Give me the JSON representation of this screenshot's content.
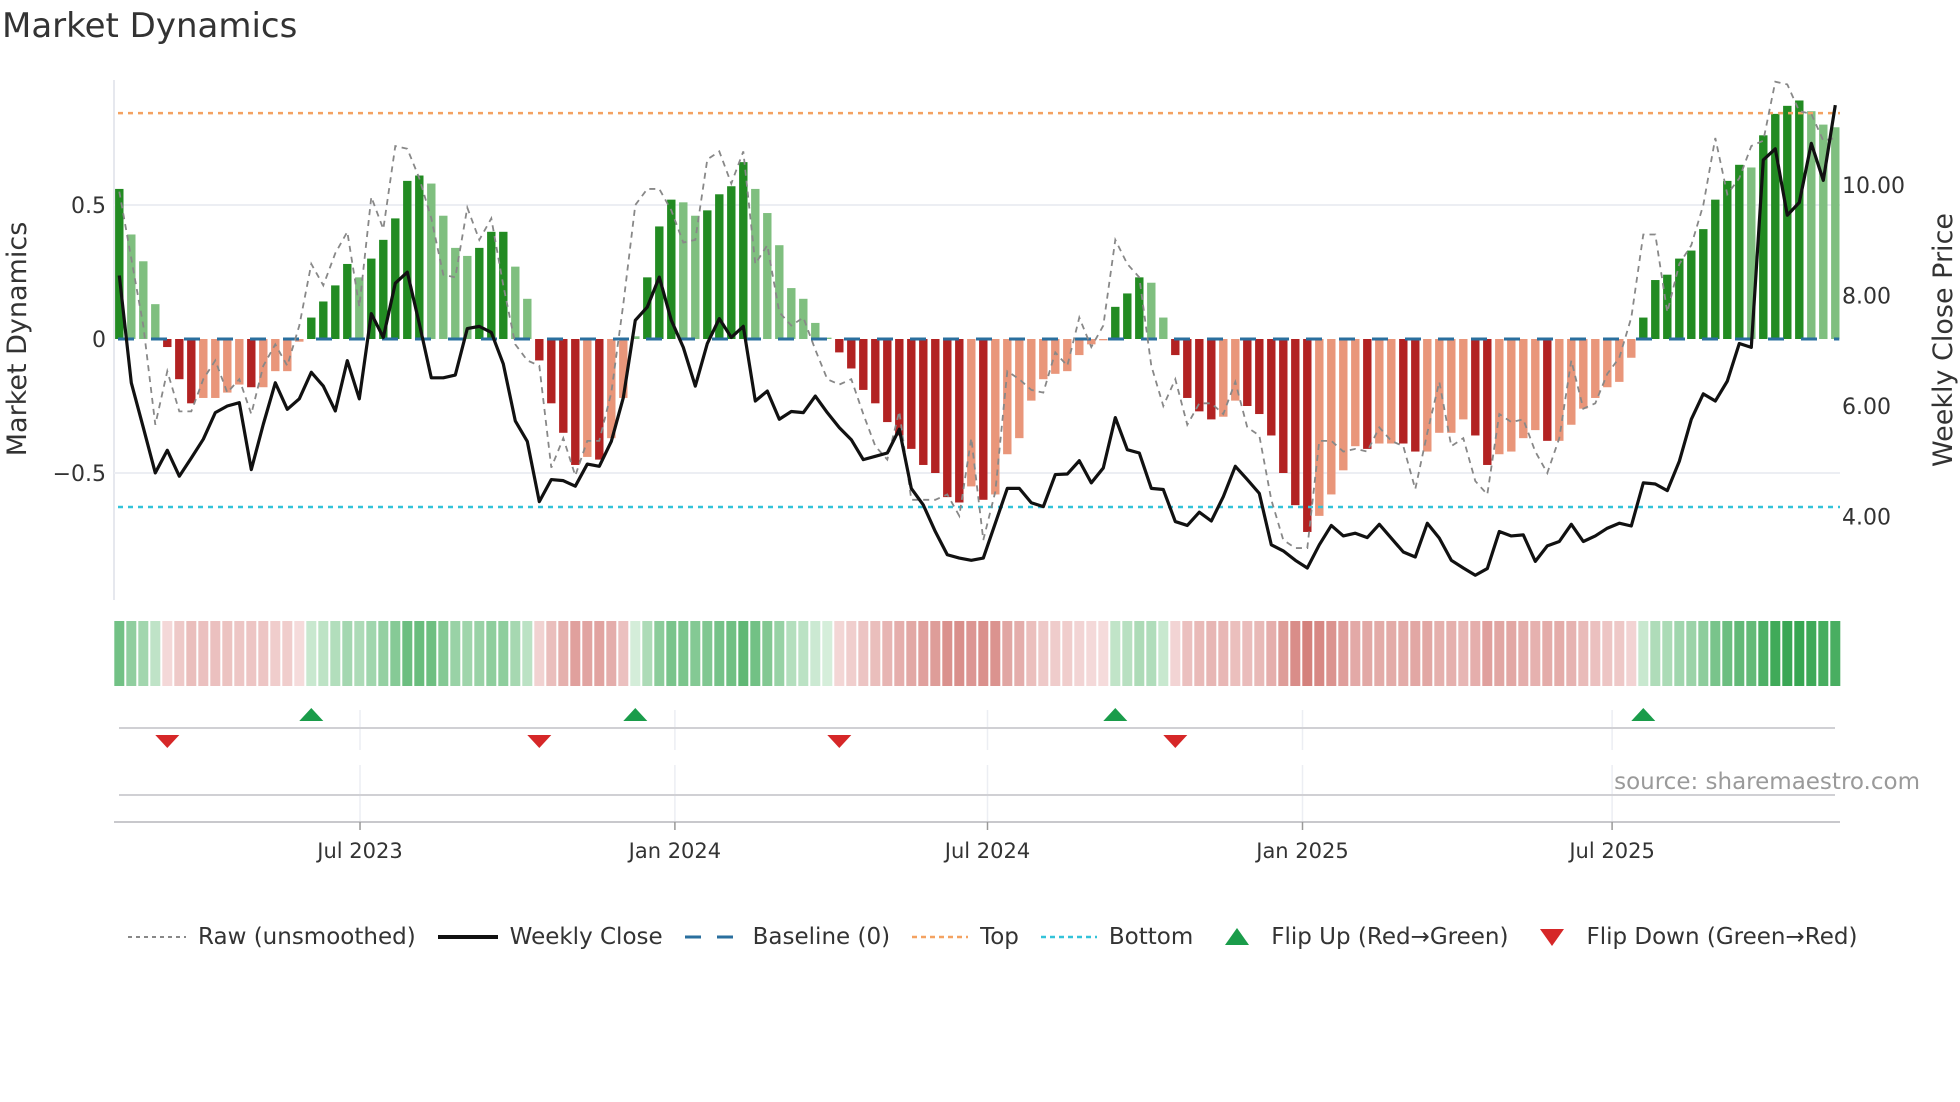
{
  "title": "Market Dynamics",
  "source": "source: sharemaestro.com",
  "legend": [
    {
      "label": "Raw (unsmoothed)",
      "style": "dotted",
      "color": "#888888"
    },
    {
      "label": "Weekly Close",
      "style": "solid",
      "color": "#111111"
    },
    {
      "label": "Baseline (0)",
      "style": "dashed",
      "color": "#2a6f9e"
    },
    {
      "label": "Top",
      "style": "dotted",
      "color": "#f4a261"
    },
    {
      "label": "Bottom",
      "style": "dotted",
      "color": "#33c3d9"
    },
    {
      "label": "Flip Up (Red→Green)",
      "style": "triangle-up",
      "color": "#1a9c4a"
    },
    {
      "label": "Flip Down (Green→Red)",
      "style": "triangle-down",
      "color": "#d62728"
    }
  ],
  "colors": {
    "strong_green": "#228b22",
    "weak_green": "#7fbf7f",
    "strong_red": "#b22222",
    "weak_red": "#e9967a",
    "flip_up": "#1a9c4a",
    "flip_down": "#d62728"
  },
  "chart_data": {
    "type": "bar",
    "title": "Market Dynamics",
    "ylabel": "Market Dynamics",
    "y2label": "Weekly Close Price",
    "ylim": [
      -0.97,
      1.0
    ],
    "y2lim": [
      2.5,
      12.0
    ],
    "yticks": [
      {
        "v": 0.5,
        "label": "0.5"
      },
      {
        "v": 0,
        "label": "0"
      },
      {
        "v": -0.5,
        "label": "−0.5"
      }
    ],
    "y2ticks": [
      {
        "v": 10,
        "label": "10.00"
      },
      {
        "v": 8,
        "label": "8.00"
      },
      {
        "v": 6,
        "label": "6.00"
      },
      {
        "v": 4,
        "label": "4.00"
      }
    ],
    "xticks": [
      {
        "week": 20.06,
        "label": "Jul 2023"
      },
      {
        "week": 46.3,
        "label": "Jan 2024"
      },
      {
        "week": 72.35,
        "label": "Jul 2024"
      },
      {
        "week": 98.6,
        "label": "Jan 2025"
      },
      {
        "week": 124.4,
        "label": "Jul 2025"
      }
    ],
    "top_level": 0.843,
    "bottom_level": -0.627,
    "baseline": 0,
    "values": [
      0.56,
      0.39,
      0.29,
      0.13,
      -0.03,
      -0.15,
      -0.24,
      -0.22,
      -0.22,
      -0.2,
      -0.17,
      -0.18,
      -0.18,
      -0.12,
      -0.12,
      -0.01,
      0.08,
      0.14,
      0.2,
      0.28,
      0.23,
      0.3,
      0.37,
      0.45,
      0.59,
      0.61,
      0.58,
      0.46,
      0.34,
      0.31,
      0.34,
      0.4,
      0.4,
      0.27,
      0.15,
      -0.08,
      -0.24,
      -0.35,
      -0.47,
      -0.44,
      -0.45,
      -0.37,
      -0.22,
      0.01,
      0.23,
      0.42,
      0.52,
      0.51,
      0.46,
      0.48,
      0.54,
      0.57,
      0.66,
      0.56,
      0.47,
      0.35,
      0.19,
      0.15,
      0.06,
      0.005,
      -0.05,
      -0.11,
      -0.19,
      -0.24,
      -0.31,
      -0.36,
      -0.41,
      -0.47,
      -0.5,
      -0.59,
      -0.61,
      -0.55,
      -0.6,
      -0.58,
      -0.43,
      -0.37,
      -0.23,
      -0.15,
      -0.13,
      -0.12,
      -0.06,
      -0.02,
      -0.005,
      0.12,
      0.17,
      0.23,
      0.21,
      0.08,
      -0.06,
      -0.22,
      -0.27,
      -0.3,
      -0.29,
      -0.23,
      -0.25,
      -0.28,
      -0.36,
      -0.5,
      -0.62,
      -0.72,
      -0.66,
      -0.58,
      -0.49,
      -0.4,
      -0.41,
      -0.39,
      -0.39,
      -0.39,
      -0.42,
      -0.42,
      -0.35,
      -0.35,
      -0.3,
      -0.36,
      -0.47,
      -0.43,
      -0.42,
      -0.37,
      -0.34,
      -0.38,
      -0.38,
      -0.32,
      -0.26,
      -0.22,
      -0.18,
      -0.16,
      -0.07,
      0.08,
      0.22,
      0.24,
      0.3,
      0.33,
      0.41,
      0.52,
      0.59,
      0.65,
      0.64,
      0.76,
      0.84,
      0.87,
      0.89,
      0.85,
      0.8,
      0.79
    ],
    "strength": "SWWWSSSWWWWSWWWWSSSSWSSSSSWWWWSSSWWSSSSWSWWWSSSWWSSSSWWWWWWWSSSSSSSSSSSWSWWWWWWWWWWSSSWWSSSSWWSSSSSSWWWWSWWSSWWWWSSWWWWSWWWWWWWSSSSSSSSSWSSSSWWW",
    "raw": [
      0.55,
      0.3,
      0.05,
      -0.32,
      -0.12,
      -0.27,
      -0.27,
      -0.15,
      -0.08,
      -0.2,
      -0.15,
      -0.28,
      -0.1,
      -0.02,
      -0.1,
      0.05,
      0.28,
      0.2,
      0.32,
      0.4,
      0.12,
      0.53,
      0.41,
      0.72,
      0.71,
      0.6,
      0.45,
      0.24,
      0.23,
      0.49,
      0.37,
      0.45,
      0.2,
      -0.02,
      -0.08,
      -0.1,
      -0.48,
      -0.37,
      -0.51,
      -0.38,
      -0.38,
      -0.2,
      0.13,
      0.5,
      0.56,
      0.56,
      0.48,
      0.36,
      0.37,
      0.67,
      0.7,
      0.58,
      0.7,
      0.28,
      0.35,
      0.1,
      0.05,
      0.08,
      -0.04,
      -0.15,
      -0.17,
      -0.15,
      -0.28,
      -0.4,
      -0.45,
      -0.27,
      -0.6,
      -0.6,
      -0.6,
      -0.58,
      -0.66,
      -0.37,
      -0.75,
      -0.57,
      -0.12,
      -0.15,
      -0.19,
      -0.2,
      -0.05,
      -0.1,
      0.08,
      -0.03,
      0.05,
      0.37,
      0.28,
      0.23,
      -0.1,
      -0.25,
      -0.15,
      -0.32,
      -0.24,
      -0.24,
      -0.28,
      -0.16,
      -0.33,
      -0.36,
      -0.6,
      -0.75,
      -0.78,
      -0.78,
      -0.38,
      -0.38,
      -0.42,
      -0.41,
      -0.42,
      -0.33,
      -0.38,
      -0.4,
      -0.56,
      -0.35,
      -0.16,
      -0.4,
      -0.37,
      -0.53,
      -0.58,
      -0.28,
      -0.31,
      -0.3,
      -0.42,
      -0.5,
      -0.37,
      -0.08,
      -0.26,
      -0.24,
      -0.13,
      -0.07,
      0.08,
      0.39,
      0.39,
      0.1,
      0.28,
      0.35,
      0.5,
      0.75,
      0.54,
      0.6,
      0.72,
      0.74,
      0.96,
      0.95,
      0.85,
      0.84,
      0.74,
      0.75
    ],
    "weekly_close": [
      8.36,
      6.42,
      5.61,
      4.79,
      5.2,
      4.73,
      5.06,
      5.4,
      5.88,
      6.0,
      6.06,
      4.85,
      5.67,
      6.42,
      5.94,
      6.13,
      6.61,
      6.36,
      5.91,
      6.82,
      6.13,
      7.67,
      7.24,
      8.22,
      8.42,
      7.49,
      6.51,
      6.51,
      6.56,
      7.4,
      7.44,
      7.33,
      6.76,
      5.73,
      5.36,
      4.27,
      4.67,
      4.65,
      4.55,
      4.95,
      4.91,
      5.36,
      6.15,
      7.55,
      7.79,
      8.33,
      7.55,
      7.06,
      6.36,
      7.13,
      7.58,
      7.24,
      7.44,
      6.09,
      6.27,
      5.76,
      5.9,
      5.88,
      6.18,
      5.88,
      5.61,
      5.39,
      5.03,
      5.09,
      5.15,
      5.58,
      4.51,
      4.21,
      3.73,
      3.31,
      3.25,
      3.21,
      3.25,
      3.88,
      4.51,
      4.51,
      4.25,
      4.18,
      4.76,
      4.77,
      5.01,
      4.61,
      4.88,
      5.79,
      5.21,
      5.15,
      4.51,
      4.49,
      3.91,
      3.84,
      4.08,
      3.92,
      4.36,
      4.91,
      4.67,
      4.42,
      3.49,
      3.38,
      3.21,
      3.07,
      3.49,
      3.84,
      3.65,
      3.7,
      3.62,
      3.86,
      3.61,
      3.36,
      3.27,
      3.88,
      3.61,
      3.21,
      3.07,
      2.94,
      3.06,
      3.73,
      3.65,
      3.67,
      3.19,
      3.47,
      3.55,
      3.86,
      3.55,
      3.65,
      3.79,
      3.88,
      3.83,
      4.61,
      4.59,
      4.47,
      5.0,
      5.76,
      6.22,
      6.09,
      6.45,
      7.13,
      7.06,
      10.45,
      10.65,
      9.45,
      9.68,
      10.75,
      10.08,
      11.44
    ],
    "flips_up": [
      16,
      43,
      83,
      127
    ],
    "flips_down": [
      4,
      35,
      60,
      88
    ],
    "grid": true,
    "legend_position": "bottom"
  }
}
